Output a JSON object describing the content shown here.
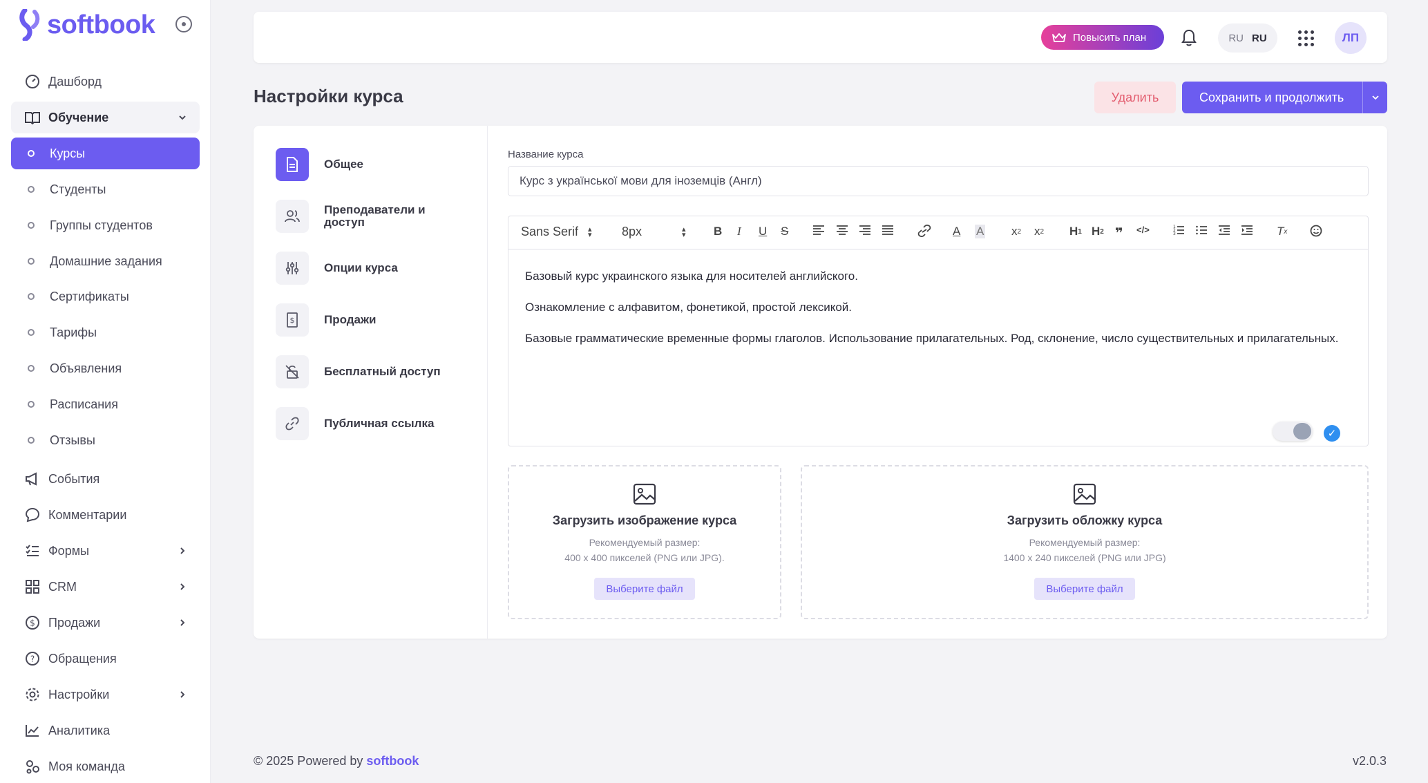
{
  "brand": {
    "name": "softbook",
    "accent": "#6c5cf0"
  },
  "sidebar": {
    "items": [
      {
        "label": "Дашборд",
        "icon": "dashboard-icon"
      },
      {
        "label": "Обучение",
        "icon": "book-icon"
      },
      {
        "label": "Курсы"
      },
      {
        "label": "Студенты"
      },
      {
        "label": "Группы студентов"
      },
      {
        "label": "Домашние задания"
      },
      {
        "label": "Сертификаты"
      },
      {
        "label": "Тарифы"
      },
      {
        "label": "Объявления"
      },
      {
        "label": "Расписания"
      },
      {
        "label": "Отзывы"
      },
      {
        "label": "События",
        "icon": "megaphone-icon"
      },
      {
        "label": "Комментарии",
        "icon": "comment-icon"
      },
      {
        "label": "Формы",
        "icon": "list-icon"
      },
      {
        "label": "CRM",
        "icon": "grid-icon"
      },
      {
        "label": "Продажи",
        "icon": "dollar-icon"
      },
      {
        "label": "Обращения",
        "icon": "help-icon"
      },
      {
        "label": "Настройки",
        "icon": "gear-icon"
      },
      {
        "label": "Аналитика",
        "icon": "analytics-icon"
      },
      {
        "label": "Моя команда",
        "icon": "team-icon"
      }
    ]
  },
  "topbar": {
    "upgrade_label": "Повысить план",
    "lang_short": "RU",
    "lang_current": "RU",
    "avatar_initials": "ЛП"
  },
  "page": {
    "title": "Настройки курса",
    "delete_label": "Удалить",
    "save_label": "Сохранить и продолжить"
  },
  "tabs": [
    {
      "label": "Общее",
      "icon": "document-icon"
    },
    {
      "label": "Преподаватели и доступ",
      "icon": "users-icon"
    },
    {
      "label": "Опции курса",
      "icon": "sliders-icon"
    },
    {
      "label": "Продажи",
      "icon": "receipt-icon"
    },
    {
      "label": "Бесплатный доступ",
      "icon": "unlock-icon"
    },
    {
      "label": "Публичная ссылка",
      "icon": "link-icon"
    }
  ],
  "form": {
    "name_label": "Название курса",
    "name_value": "Курс з української мови для іноземців (Англ)",
    "font_select": "Sans Serif",
    "size_select": "8px",
    "description": [
      "Базовый курс украинского языка для носителей английского.",
      "Ознакомление с алфавитом, фонетикой, простой лексикой.",
      "Базовые грамматические временные формы глаголов. Использование прилагательных. Род, склонение, число существительных и прилагательных."
    ]
  },
  "uploads": {
    "image": {
      "title": "Загрузить изображение курса",
      "hint1": "Рекомендуемый размер:",
      "hint2": "400 x 400 пикселей (PNG или JPG).",
      "button": "Выберите файл"
    },
    "cover": {
      "title": "Загрузить обложку курса",
      "hint1": "Рекомендуемый размер:",
      "hint2": "1400 x 240 пикселей (PNG или JPG)",
      "button": "Выберите файл"
    }
  },
  "footer": {
    "copyright": "© 2025 Powered by",
    "brand": "softbook",
    "version": "v2.0.3"
  }
}
